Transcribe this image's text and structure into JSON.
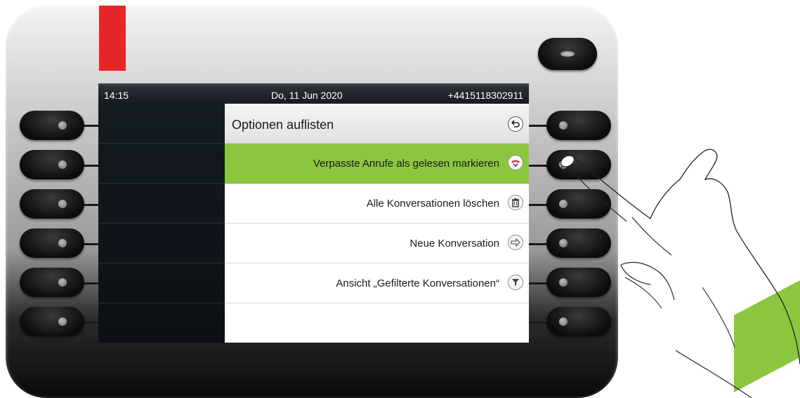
{
  "status_bar": {
    "time": "14:15",
    "date": "Do, 11 Jun 2020",
    "number": "+4415118302911"
  },
  "menu": {
    "title": "Optionen auflisten",
    "title_icon": "back-arrow-icon",
    "items": [
      {
        "label": "Verpasste Anrufe als gelesen markieren",
        "icon": "missed-call-icon",
        "selected": true
      },
      {
        "label": "Alle Konversationen löschen",
        "icon": "trash-icon",
        "selected": false
      },
      {
        "label": "Neue Konversation",
        "icon": "forward-arrow-icon",
        "selected": false
      },
      {
        "label": "Ansicht „Gefilterte Konversationen“",
        "icon": "filter-icon",
        "selected": false
      },
      {
        "label": "",
        "icon": "",
        "selected": false
      }
    ]
  },
  "colors": {
    "accent_green": "#8cc63f",
    "brand_red": "#e8262a",
    "screen_dark": "#10161c"
  }
}
